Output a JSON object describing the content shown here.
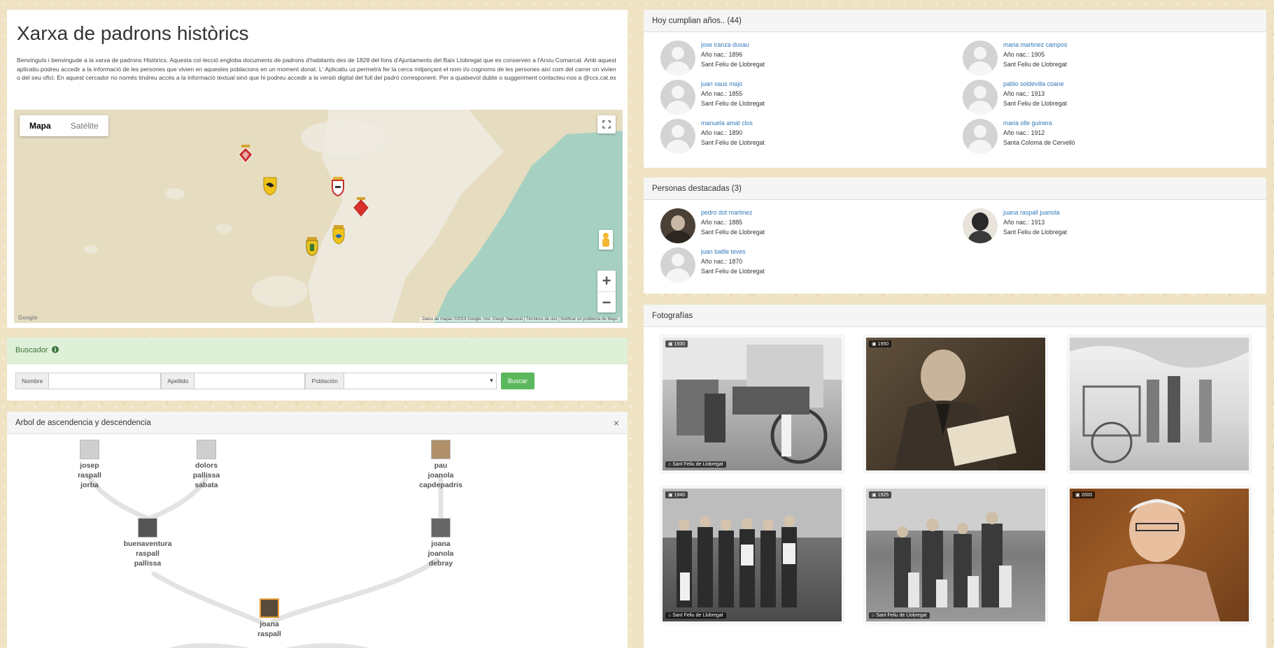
{
  "intro": {
    "title": "Xarxa de padrons històrics",
    "text": "Benvinguts i benvingude a la xarxa de padrons Històrics. Aquesta col·lecció engloba documents de padrons d'habitants des de 1828 del fons d'Ajuntaments del Baix Llobregat que es conserven a l'Arxiu Comarcal. Amb aquest aplicatiu podreu accedir a la informació de les persones que vivien en aquestes poblacions en un moment donat. L' Aplicatiu us permetrà fer la cerca mitjançant el nom i/o cognoms de les persones així com del carrer on vivien o del seu ofici. En aquest cercador no només tindreu accés a la informació textual sinó que hi podreu accedir a la versió digital del full del padró corresponent. Per a qualsevol dubte o suggeriment contacteu-nos a @ccs.cat.es"
  },
  "map": {
    "type_map": "Mapa",
    "type_satellite": "Satélite",
    "fullscreen_icon": "fullscreen-icon",
    "zoom_in": "+",
    "zoom_out": "−",
    "attribution": "Datos de mapas ©2019 Google, Inst. Geogr. Nacional | Términos de uso | Notificar un problema de Maps",
    "logo": "Google",
    "colors": {
      "land": "#e6dcc0",
      "sea": "#a6d1c2",
      "urban": "#efebe2"
    }
  },
  "search": {
    "title": "Buscador",
    "info_icon": "info-circle-icon",
    "name_label": "Nombre",
    "surname_label": "Apellido",
    "population_label": "Población",
    "search_button": "Buscar",
    "button_color": "#5cb85c"
  },
  "tree": {
    "title": "Arbol de ascendencia y descendencia",
    "close": "×",
    "nodes": [
      {
        "name": "josep\nraspall\njorba"
      },
      {
        "name": "dolors\npallissa\nsabata"
      },
      {
        "name": "pau\njoanola\ncapdepadris"
      },
      {
        "name": "buenaventura\nraspall\npallissa"
      },
      {
        "name": "joana\njoanola\ndebray"
      },
      {
        "name": "joana\nraspall"
      }
    ]
  },
  "birthdays": {
    "title": "Hoy cumplian años.. (44)",
    "people": [
      {
        "name": "jose iranza dusau",
        "year": "Año nac.: 1896",
        "place": "Sant Feliu de Llobregat"
      },
      {
        "name": "maria martinez campos",
        "year": "Año nac.: 1905",
        "place": "Sant Feliu de Llobregat"
      },
      {
        "name": "juan xaus majo",
        "year": "Año nac.: 1855",
        "place": "Sant Feliu de Llobregat"
      },
      {
        "name": "pablo soldevilla coane",
        "year": "Año nac.: 1913",
        "place": "Sant Feliu de Llobregat"
      },
      {
        "name": "manuela amat clos",
        "year": "Año nac.: 1890",
        "place": "Sant Feliu de Llobregat"
      },
      {
        "name": "maria olle guinera",
        "year": "Año nac.: 1912",
        "place": "Santa Coloma de Cervelló"
      }
    ]
  },
  "notable": {
    "title": "Personas destacadas (3)",
    "people": [
      {
        "name": "pedro dot martinez",
        "year": "Año nac.: 1885",
        "place": "Sant Feliu de Llobregat"
      },
      {
        "name": "juana raspall juanola",
        "year": "Año nac.: 1913",
        "place": "Sant Feliu de Llobregat"
      },
      {
        "name": "juan batlle teves",
        "year": "Año nac.: 1870",
        "place": "Sant Feliu de Llobregat"
      }
    ]
  },
  "photos": {
    "title": "Fotografías",
    "items": [
      {
        "year": "1930",
        "place": "Sant Feliu de Llobregat"
      },
      {
        "year": "1950",
        "place": ""
      },
      {
        "year": "",
        "place": ""
      },
      {
        "year": "1940",
        "place": "Sant Feliu de Llobregat"
      },
      {
        "year": "1925",
        "place": "Sant Feliu de Llobregat"
      },
      {
        "year": "2000",
        "place": ""
      }
    ]
  }
}
